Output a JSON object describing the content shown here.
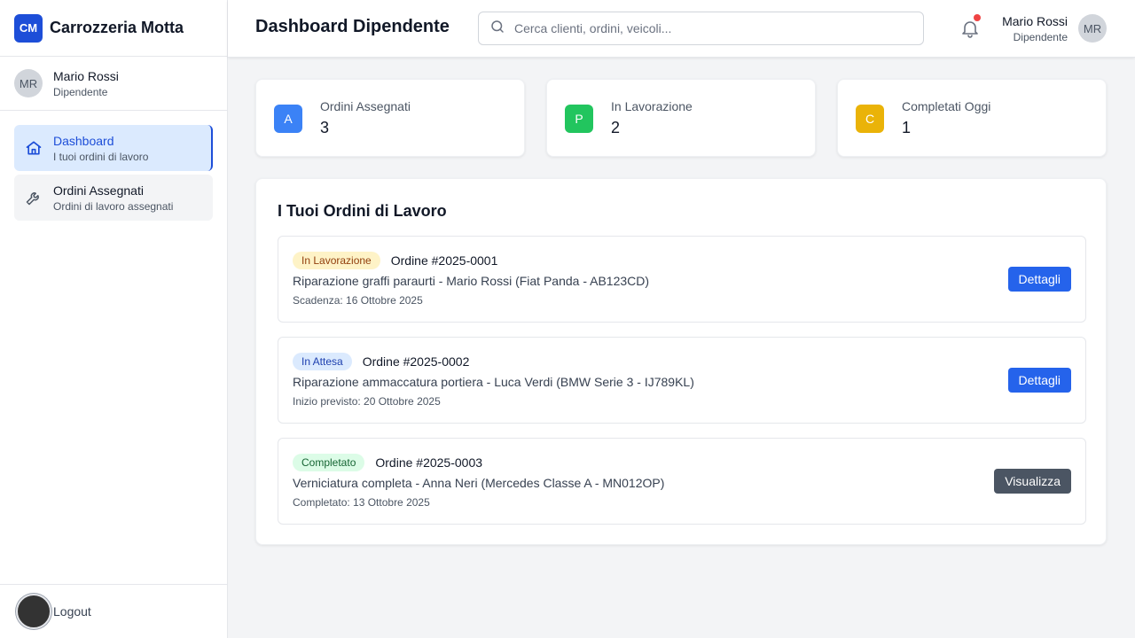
{
  "brand": {
    "logo": "CM",
    "name": "Carrozzeria Motta"
  },
  "sidebar_user": {
    "initials": "MR",
    "name": "Mario Rossi",
    "role": "Dipendente"
  },
  "nav": {
    "items": [
      {
        "label": "Dashboard",
        "sub": "I tuoi ordini di lavoro",
        "icon": "home-icon",
        "active": true
      },
      {
        "label": "Ordini Assegnati",
        "sub": "Ordini di lavoro assegnati",
        "icon": "wrench-icon",
        "active": false
      }
    ]
  },
  "logout_label": "Logout",
  "header": {
    "title": "Dashboard Dipendente",
    "search_placeholder": "Cerca clienti, ordini, veicoli...",
    "user_name": "Mario Rossi",
    "user_role": "Dipendente",
    "user_initials": "MR",
    "has_notification": true
  },
  "stats": [
    {
      "icon_letter": "A",
      "label": "Ordini Assegnati",
      "value": "3",
      "color": "#3b82f6"
    },
    {
      "icon_letter": "P",
      "label": "In Lavorazione",
      "value": "2",
      "color": "#22c55e"
    },
    {
      "icon_letter": "C",
      "label": "Completati Oggi",
      "value": "1",
      "color": "#eab308"
    }
  ],
  "orders_panel": {
    "title": "I Tuoi Ordini di Lavoro",
    "orders": [
      {
        "status": "In Lavorazione",
        "number": "Ordine #2025-0001",
        "description": "Riparazione graffi paraurti - Mario Rossi (Fiat Panda - AB123CD)",
        "date": "Scadenza: 16 Ottobre 2025",
        "button": "Dettagli"
      },
      {
        "status": "In Attesa",
        "number": "Ordine #2025-0002",
        "description": "Riparazione ammaccatura portiera - Luca Verdi (BMW Serie 3 - IJ789KL)",
        "date": "Inizio previsto: 20 Ottobre 2025",
        "button": "Dettagli"
      },
      {
        "status": "Completato",
        "number": "Ordine #2025-0003",
        "description": "Verniciatura completa - Anna Neri (Mercedes Classe A - MN012OP)",
        "date": "Completato: 13 Ottobre 2025",
        "button": "Visualizza"
      }
    ]
  },
  "colors": {
    "accent": "#1d4ed8",
    "button_primary": "#2563eb",
    "button_secondary": "#4b5563",
    "badge_in_lavorazione_bg": "#fef3c7",
    "badge_in_lavorazione_text": "#92400e",
    "badge_in_attesa_bg": "#dbeafe",
    "badge_in_attesa_text": "#1e40af",
    "badge_completato_bg": "#dcfce7",
    "badge_completato_text": "#166534",
    "notification_dot": "#ef4444"
  }
}
